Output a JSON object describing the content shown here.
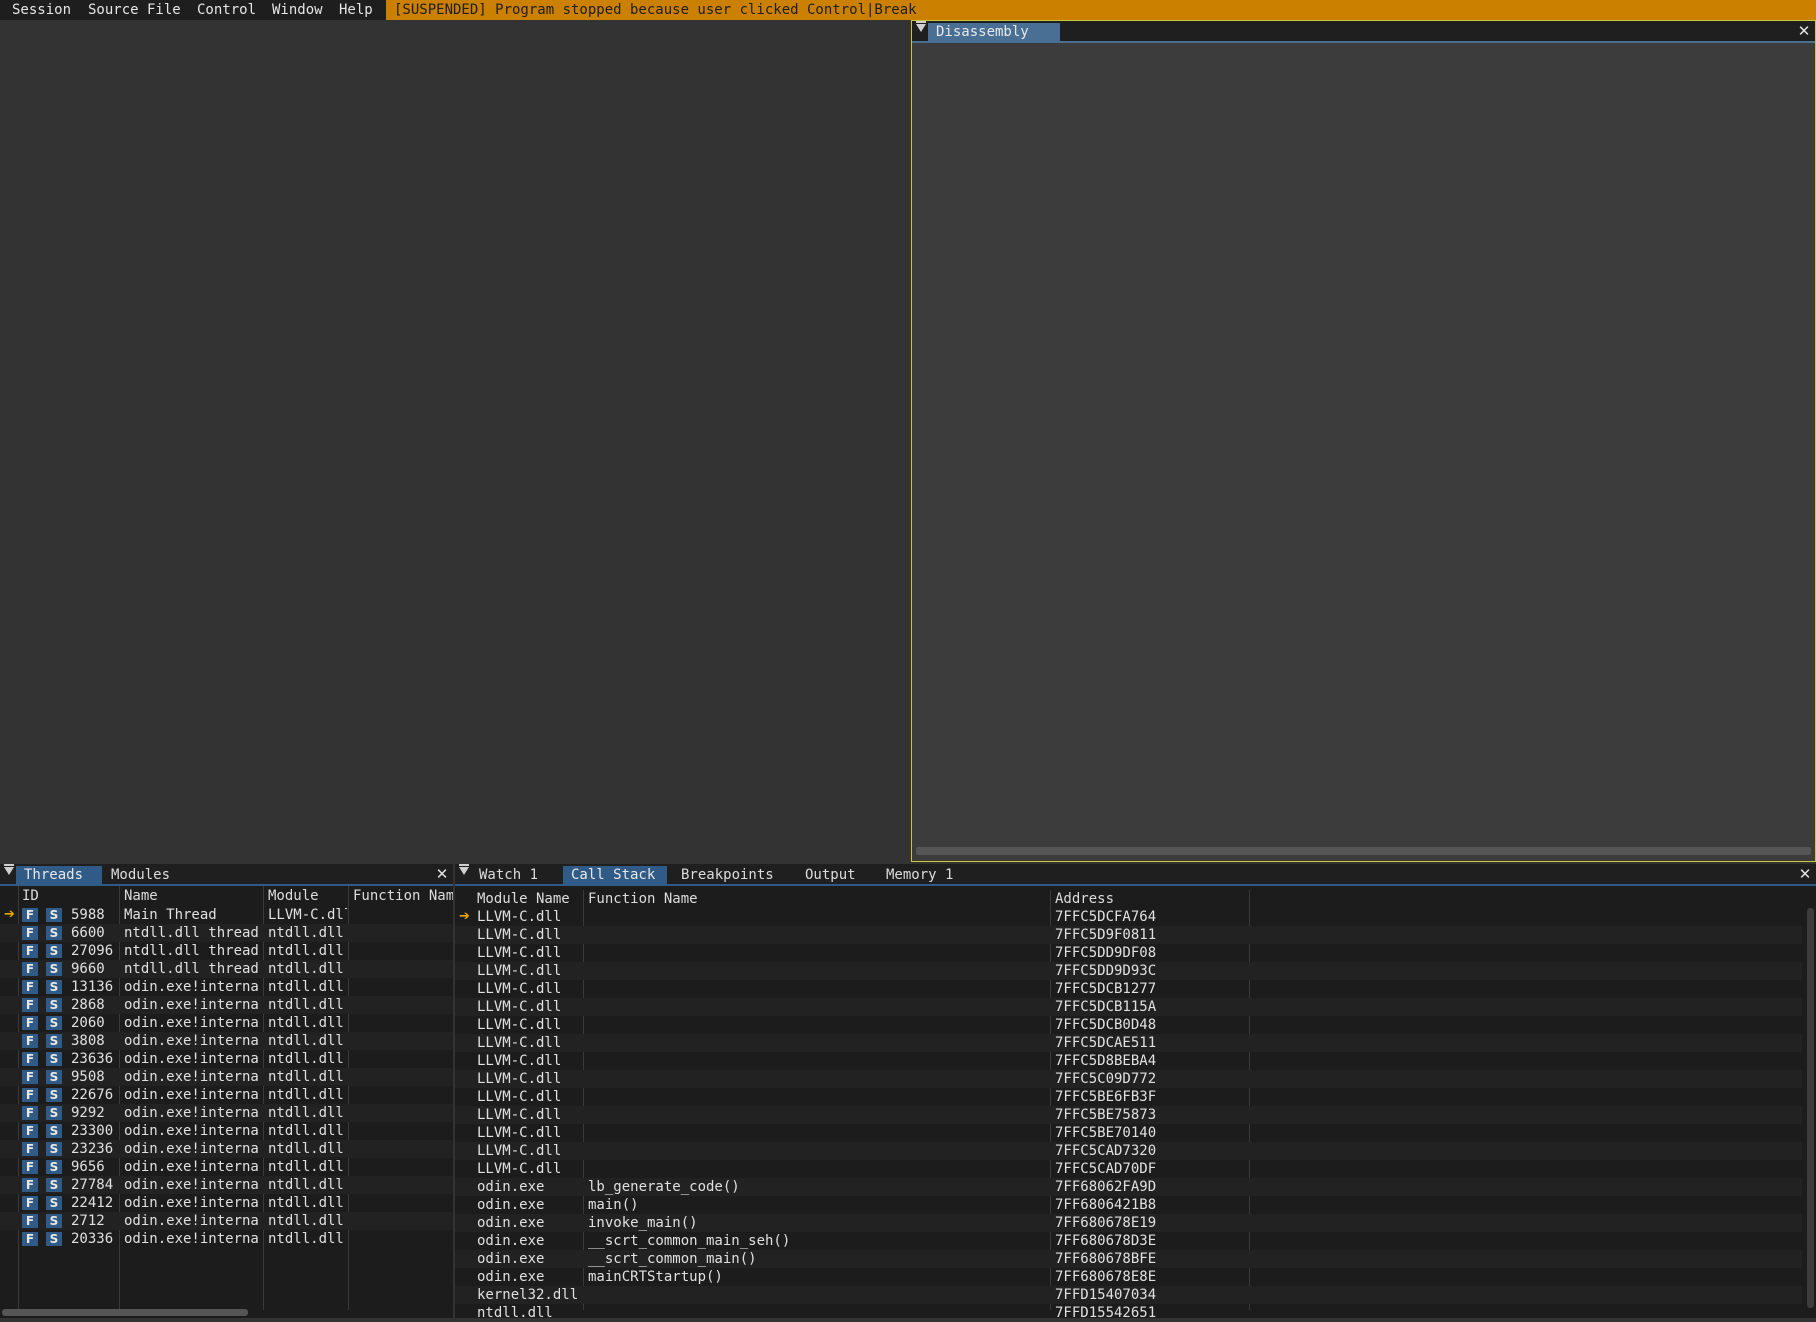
{
  "menubar": {
    "items": [
      "Session",
      "Source File",
      "Control",
      "Window",
      "Help"
    ],
    "status": "[SUSPENDED] Program stopped because user clicked Control|Break",
    "status_color": "#cc8000"
  },
  "disassembly": {
    "tab": "Disassembly",
    "accent": "#c8c83c"
  },
  "threads_panel": {
    "tabs": [
      "Threads",
      "Modules"
    ],
    "columns": [
      "ID",
      "Name",
      "Module",
      "Function Nam"
    ],
    "btn_f": "F",
    "btn_s": "S",
    "rows": [
      {
        "id": "5988",
        "name": "Main Thread",
        "module": "LLVM-C.dll",
        "current": true
      },
      {
        "id": "6600",
        "name": "ntdll.dll thread",
        "module": "ntdll.dll"
      },
      {
        "id": "27096",
        "name": "ntdll.dll thread",
        "module": "ntdll.dll"
      },
      {
        "id": "9660",
        "name": "ntdll.dll thread",
        "module": "ntdll.dll"
      },
      {
        "id": "13136",
        "name": "odin.exe!interna",
        "module": "ntdll.dll"
      },
      {
        "id": "2868",
        "name": "odin.exe!interna",
        "module": "ntdll.dll"
      },
      {
        "id": "2060",
        "name": "odin.exe!interna",
        "module": "ntdll.dll"
      },
      {
        "id": "3808",
        "name": "odin.exe!interna",
        "module": "ntdll.dll"
      },
      {
        "id": "23636",
        "name": "odin.exe!interna",
        "module": "ntdll.dll"
      },
      {
        "id": "9508",
        "name": "odin.exe!interna",
        "module": "ntdll.dll"
      },
      {
        "id": "22676",
        "name": "odin.exe!interna",
        "module": "ntdll.dll"
      },
      {
        "id": "9292",
        "name": "odin.exe!interna",
        "module": "ntdll.dll"
      },
      {
        "id": "23300",
        "name": "odin.exe!interna",
        "module": "ntdll.dll"
      },
      {
        "id": "23236",
        "name": "odin.exe!interna",
        "module": "ntdll.dll"
      },
      {
        "id": "9656",
        "name": "odin.exe!interna",
        "module": "ntdll.dll"
      },
      {
        "id": "27784",
        "name": "odin.exe!interna",
        "module": "ntdll.dll"
      },
      {
        "id": "22412",
        "name": "odin.exe!interna",
        "module": "ntdll.dll"
      },
      {
        "id": "2712",
        "name": "odin.exe!interna",
        "module": "ntdll.dll"
      },
      {
        "id": "20336",
        "name": "odin.exe!interna",
        "module": "ntdll.dll"
      }
    ]
  },
  "stack_panel": {
    "tabs": [
      "Watch 1",
      "Call Stack",
      "Breakpoints",
      "Output",
      "Memory 1"
    ],
    "active_tab": 1,
    "columns": [
      "Module Name",
      "Function Name",
      "Address"
    ],
    "rows": [
      {
        "module": "LLVM-C.dll",
        "func": "",
        "addr": "7FFC5DCFA764",
        "current": true
      },
      {
        "module": "LLVM-C.dll",
        "func": "",
        "addr": "7FFC5D9F0811"
      },
      {
        "module": "LLVM-C.dll",
        "func": "",
        "addr": "7FFC5DD9DF08"
      },
      {
        "module": "LLVM-C.dll",
        "func": "",
        "addr": "7FFC5DD9D93C"
      },
      {
        "module": "LLVM-C.dll",
        "func": "",
        "addr": "7FFC5DCB1277"
      },
      {
        "module": "LLVM-C.dll",
        "func": "",
        "addr": "7FFC5DCB115A"
      },
      {
        "module": "LLVM-C.dll",
        "func": "",
        "addr": "7FFC5DCB0D48"
      },
      {
        "module": "LLVM-C.dll",
        "func": "",
        "addr": "7FFC5DCAE511"
      },
      {
        "module": "LLVM-C.dll",
        "func": "",
        "addr": "7FFC5D8BEBA4"
      },
      {
        "module": "LLVM-C.dll",
        "func": "",
        "addr": "7FFC5C09D772"
      },
      {
        "module": "LLVM-C.dll",
        "func": "",
        "addr": "7FFC5BE6FB3F"
      },
      {
        "module": "LLVM-C.dll",
        "func": "",
        "addr": "7FFC5BE75873"
      },
      {
        "module": "LLVM-C.dll",
        "func": "",
        "addr": "7FFC5BE70140"
      },
      {
        "module": "LLVM-C.dll",
        "func": "",
        "addr": "7FFC5CAD7320"
      },
      {
        "module": "LLVM-C.dll",
        "func": "",
        "addr": "7FFC5CAD70DF"
      },
      {
        "module": "odin.exe",
        "func": "lb_generate_code()",
        "addr": "7FF68062FA9D"
      },
      {
        "module": "odin.exe",
        "func": "main()",
        "addr": "7FF6806421B8"
      },
      {
        "module": "odin.exe",
        "func": "invoke_main()",
        "addr": "7FF680678E19"
      },
      {
        "module": "odin.exe",
        "func": "__scrt_common_main_seh()",
        "addr": "7FF680678D3E"
      },
      {
        "module": "odin.exe",
        "func": "__scrt_common_main()",
        "addr": "7FF680678BFE"
      },
      {
        "module": "odin.exe",
        "func": "mainCRTStartup()",
        "addr": "7FF680678E8E"
      },
      {
        "module": "kernel32.dll",
        "func": "",
        "addr": "7FFD15407034"
      },
      {
        "module": "ntdll.dll",
        "func": "",
        "addr": "7FFD15542651"
      }
    ]
  }
}
